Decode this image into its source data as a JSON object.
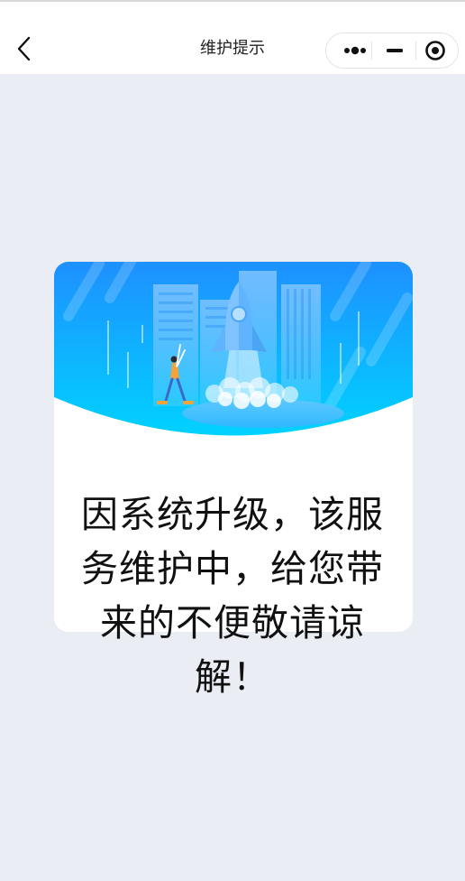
{
  "navbar": {
    "title": "维护提示",
    "back_icon": "chevron-left-icon",
    "capsule": {
      "more_icon": "more-dots-icon",
      "minimize_icon": "minimize-icon",
      "close_icon": "target-circle-icon"
    }
  },
  "card": {
    "illustration": "rocket-launch-illustration",
    "message": "因系统升级，该服务维护中，给您带来的不便敬请谅解！"
  },
  "colors": {
    "page_background": "#eaedf4",
    "banner_top": "#1e90ff",
    "banner_bottom": "#00d2ff"
  }
}
